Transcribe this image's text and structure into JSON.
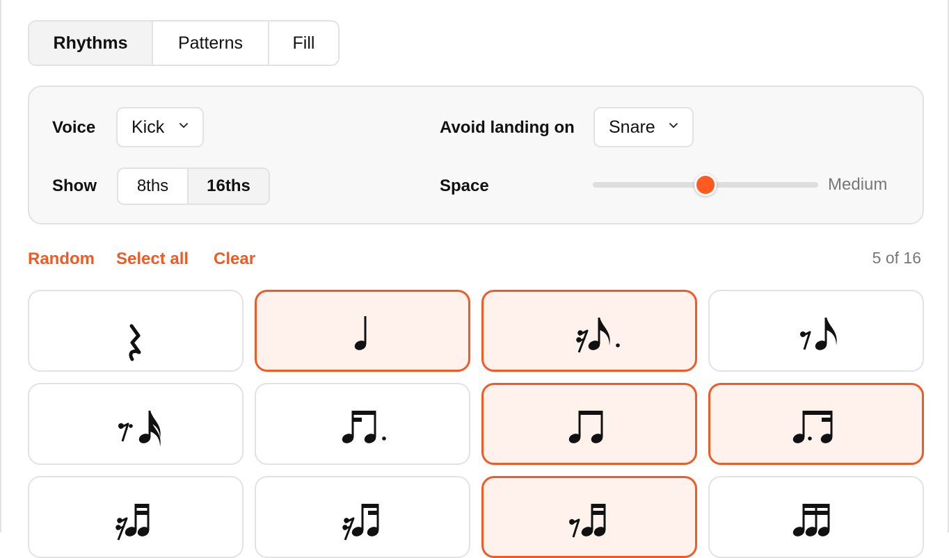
{
  "tabs": [
    {
      "label": "Rhythms",
      "active": true
    },
    {
      "label": "Patterns",
      "active": false
    },
    {
      "label": "Fill",
      "active": false
    }
  ],
  "settings": {
    "voice_label": "Voice",
    "voice_value": "Kick",
    "avoid_label": "Avoid landing on",
    "avoid_value": "Snare",
    "show_label": "Show",
    "show_options": [
      "8ths",
      "16ths"
    ],
    "show_selected": "16ths",
    "space_label": "Space",
    "space_value": "Medium",
    "space_level": 0.5,
    "chevron_icon": "chevron-down-icon"
  },
  "actions": {
    "random": "Random",
    "select_all": "Select all",
    "clear": "Clear",
    "count": "5 of 16"
  },
  "colors": {
    "accent": "#f05a24",
    "selected_bg": "#fff1ec",
    "border": "#e2e2e2",
    "panel_bg": "#f8f8f8",
    "muted_text": "#777777"
  },
  "rhythms": [
    {
      "icon": "quarter-rest-icon",
      "selected": false
    },
    {
      "icon": "quarter-note-icon",
      "selected": true
    },
    {
      "icon": "sixteenth-rest-dotted-eighth-note-icon",
      "selected": true
    },
    {
      "icon": "eighth-rest-eighth-note-icon",
      "selected": false
    },
    {
      "icon": "dotted-eighth-rest-sixteenth-note-icon",
      "selected": false
    },
    {
      "icon": "sixteenth-dotted-eighth-beamed-icon",
      "selected": false
    },
    {
      "icon": "two-eighth-notes-beamed-icon",
      "selected": true
    },
    {
      "icon": "dotted-eighth-sixteenth-beamed-icon",
      "selected": true
    },
    {
      "icon": "sixteenth-rest-three-sixteenths-icon",
      "selected": false
    },
    {
      "icon": "sixteenth-rest-sixteenth-eighth-icon",
      "selected": false
    },
    {
      "icon": "eighth-rest-two-sixteenths-icon",
      "selected": true
    },
    {
      "icon": "four-sixteenth-notes-icon",
      "selected": false
    }
  ]
}
